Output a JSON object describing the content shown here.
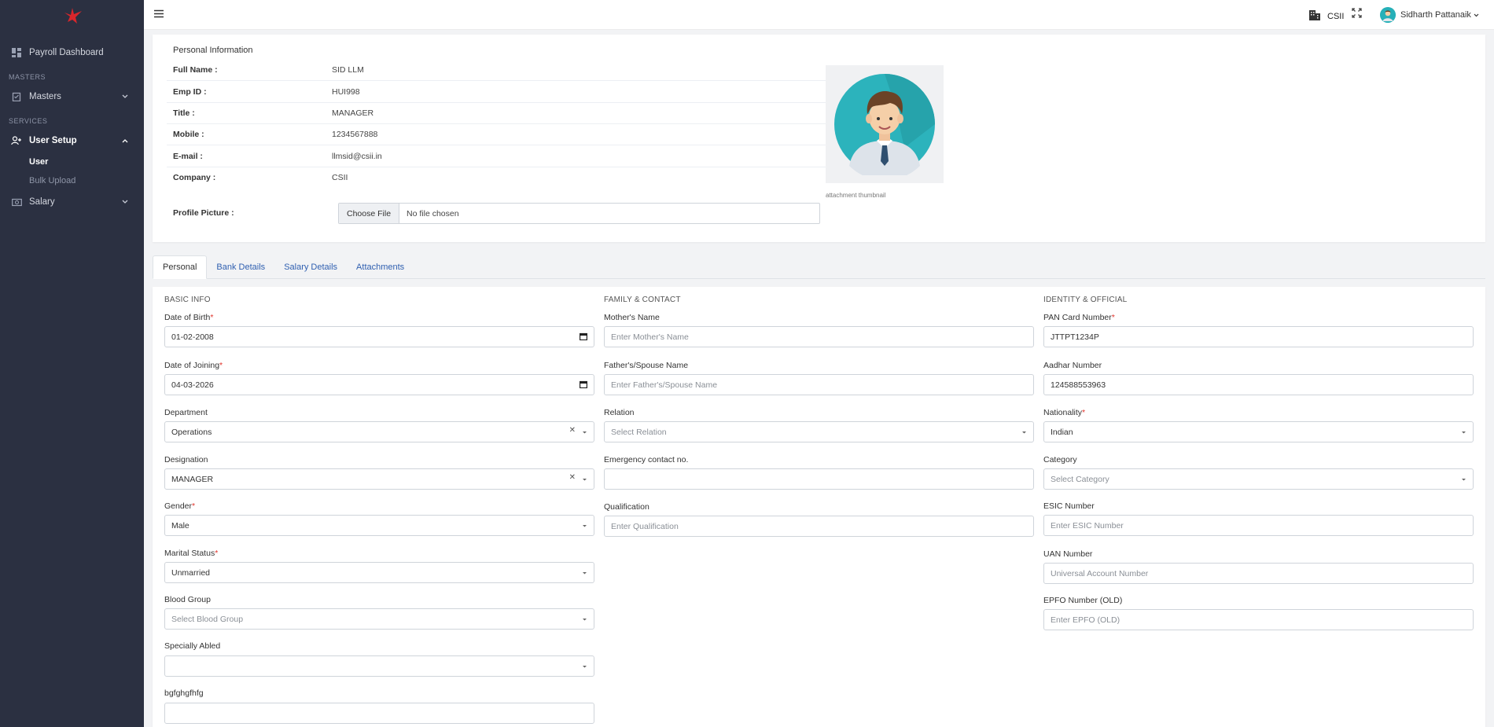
{
  "sidebar": {
    "dashboard": "Payroll Dashboard",
    "sec_masters": "MASTERS",
    "masters": "Masters",
    "sec_services": "SERVICES",
    "user_setup": "User Setup",
    "user": "User",
    "bulk_upload": "Bulk Upload",
    "salary": "Salary"
  },
  "header": {
    "company": "CSII",
    "user_name": "Sidharth Pattanaik"
  },
  "personal_info": {
    "title": "Personal Information",
    "rows": [
      {
        "label": "Full Name :",
        "value": "SID LLM"
      },
      {
        "label": "Emp ID :",
        "value": "HUI998"
      },
      {
        "label": "Title :",
        "value": "MANAGER"
      },
      {
        "label": "Mobile :",
        "value": "1234567888"
      },
      {
        "label": "E-mail :",
        "value": "llmsid@csii.in"
      },
      {
        "label": "Company :",
        "value": "CSII"
      }
    ],
    "profile_picture_label": "Profile Picture :",
    "choose_file": "Choose File",
    "no_file": "No file chosen",
    "thumbnail_caption": "attachment thumbnail"
  },
  "tabs": [
    "Personal",
    "Bank Details",
    "Salary Details",
    "Attachments"
  ],
  "basic": {
    "heading": "BASIC INFO",
    "dob_label": "Date of Birth",
    "dob": "01-02-2008",
    "doj_label": "Date of Joining",
    "doj": "04-03-2026",
    "dept_label": "Department",
    "dept": "Operations",
    "desig_label": "Designation",
    "desig": "MANAGER",
    "gender_label": "Gender",
    "gender": "Male",
    "marital_label": "Marital Status",
    "marital": "Unmarried",
    "blood_label": "Blood Group",
    "blood_ph": "Select Blood Group",
    "specially_label": "Specially Abled",
    "specially": "",
    "extra_label": "bgfghgfhfg"
  },
  "family": {
    "heading": "FAMILY & CONTACT",
    "mother_label": "Mother's Name",
    "mother_ph": "Enter Mother's Name",
    "father_label": "Father's/Spouse Name",
    "father_ph": "Enter Father's/Spouse Name",
    "relation_label": "Relation",
    "relation_ph": "Select Relation",
    "emergency_label": "Emergency contact no.",
    "emergency": "",
    "qual_label": "Qualification",
    "qual_ph": "Enter Qualification"
  },
  "identity": {
    "heading": "IDENTITY & OFFICIAL",
    "pan_label": "PAN Card Number",
    "pan": "JTTPT1234P",
    "aadhar_label": "Aadhar Number",
    "aadhar": "124588553963",
    "nation_label": "Nationality",
    "nation": "Indian",
    "category_label": "Category",
    "category_ph": "Select Category",
    "esic_label": "ESIC Number",
    "esic_ph": "Enter ESIC Number",
    "uan_label": "UAN Number",
    "uan_ph": "Universal Account Number",
    "epfo_label": "EPFO Number (OLD)",
    "epfo_ph": "Enter EPFO (OLD)"
  },
  "colors": {
    "sidebar": "#2b3041",
    "accent": "#2f5fb0",
    "required": "#e0342c",
    "logo": "#d9262b"
  }
}
